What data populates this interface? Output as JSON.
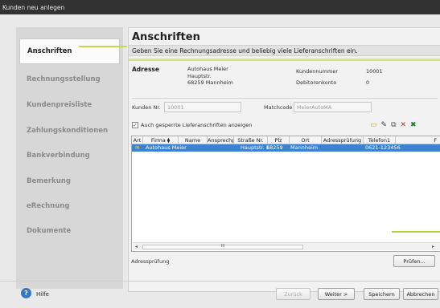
{
  "window": {
    "title": "Kunden neu anlegen"
  },
  "nav": {
    "items": [
      {
        "label": "Anschriften",
        "active": true
      },
      {
        "label": "Rechnungsstellung"
      },
      {
        "label": "Kundenpreisliste"
      },
      {
        "label": "Zahlungskonditionen"
      },
      {
        "label": "Bankverbindung"
      },
      {
        "label": "Bemerkung"
      },
      {
        "label": "eRechnung"
      },
      {
        "label": "Dokumente"
      }
    ]
  },
  "main": {
    "title": "Anschriften",
    "subtitle": "Geben Sie eine Rechnungsadresse und beliebig viele Lieferanschriften ein.",
    "address_label": "Adresse",
    "address": [
      "Autohaus Meier",
      "Hauptstr.",
      "68259 Mannheim"
    ],
    "kundennummer_label": "Kundennummer",
    "kundennummer_value": "10001",
    "debitorenkonto_label": "Debitorenkonto",
    "debitorenkonto_value": "0",
    "kunden_nr_label": "Kunden Nr.",
    "kunden_nr_value": "10001",
    "matchcode_label": "Matchcode",
    "matchcode_value": "MeierAutoMA",
    "checkbox_label": "Auch gesperrte Lieferanschriften anzeigen",
    "checkbox_checked": true,
    "toolbar_icons": [
      "new-folder-icon",
      "edit-pencil-icon",
      "copy-icon",
      "delete-icon",
      "excel-export-icon"
    ],
    "grid": {
      "columns": [
        "Art",
        "Firma",
        "Name",
        "Ansprechp",
        "Straße Nr.",
        "Plz",
        "Ort",
        "Adressprüfung",
        "Telefon1",
        "F"
      ],
      "rows": [
        {
          "art": "envelope-icon",
          "firma": "Autohaus Meier",
          "name": "",
          "ansprechp": "",
          "strasse": "Hauptstr. 1",
          "plz": "68259",
          "ort": "Mannheim",
          "adresspruefung": "",
          "telefon1": "0621-123456"
        }
      ],
      "scroll_mark": "III"
    },
    "adresspruefung_label": "Adressprüfung",
    "pruefen_button": "Prüfen..."
  },
  "footer": {
    "help_label": "Hilfe",
    "back_button": "Zurück",
    "next_button": "Weiter >",
    "save_button": "Speichern",
    "cancel_button": "Abbrechen"
  }
}
